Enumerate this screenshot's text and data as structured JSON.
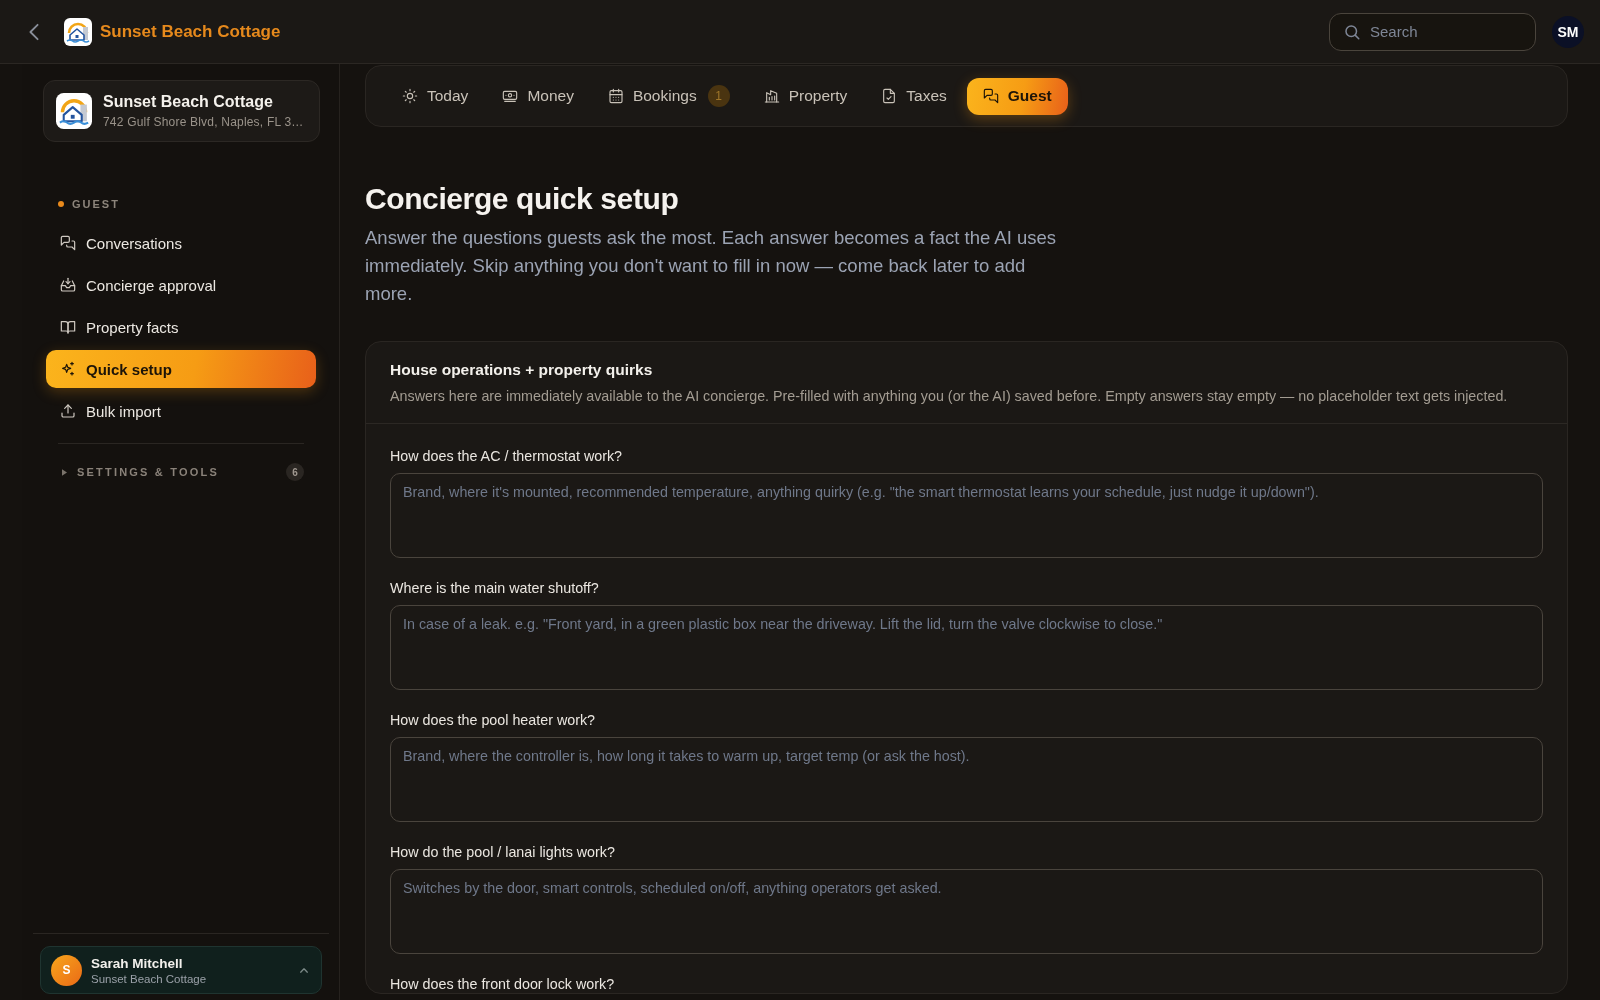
{
  "top_bar": {
    "title": "Sunset Beach Cottage",
    "search": {
      "placeholder": "Search"
    },
    "avatar": "SM"
  },
  "sidebar": {
    "property": {
      "name": "Sunset Beach Cottage",
      "address": "742 Gulf Shore Blvd, Naples, FL 3…"
    },
    "section": "GUEST",
    "items": [
      {
        "label": "Conversations",
        "selected": false
      },
      {
        "label": "Concierge approval",
        "selected": false
      },
      {
        "label": "Property facts",
        "selected": false
      },
      {
        "label": "Quick setup",
        "selected": true
      },
      {
        "label": "Bulk import",
        "selected": false
      }
    ],
    "settings": {
      "label": "SETTINGS & TOOLS",
      "expanded": false,
      "count": "6"
    },
    "user": {
      "initial": "S",
      "name": "Sarah Mitchell",
      "subtitle": "Sunset Beach Cottage"
    }
  },
  "tabs": [
    {
      "label": "Today",
      "selected": false
    },
    {
      "label": "Money",
      "selected": false
    },
    {
      "label": "Bookings",
      "badge": "1",
      "selected": false
    },
    {
      "label": "Property",
      "selected": false
    },
    {
      "label": "Taxes",
      "selected": false
    },
    {
      "label": "Guest",
      "selected": true
    }
  ],
  "page": {
    "title": "Concierge quick setup",
    "intro": "Answer the questions guests ask the most. Each answer becomes a fact the AI uses immediately. Skip anything you don't want to fill in now — come back later to add more."
  },
  "card": {
    "title": "House operations + property quirks",
    "description": "Answers here are immediately available to the AI concierge. Pre-filled with anything you (or the AI) saved before. Empty answers stay empty — no placeholder text gets injected.",
    "questions": [
      {
        "label": "How does the AC / thermostat work?",
        "placeholder": "Brand, where it's mounted, recommended temperature, anything quirky (e.g. \"the smart thermostat learns your schedule, just nudge it up/down\")."
      },
      {
        "label": "Where is the main water shutoff?",
        "placeholder": "In case of a leak. e.g. \"Front yard, in a green plastic box near the driveway. Lift the lid, turn the valve clockwise to close.\""
      },
      {
        "label": "How does the pool heater work?",
        "placeholder": "Brand, where the controller is, how long it takes to warm up, target temp (or ask the host)."
      },
      {
        "label": "How do the pool / lanai lights work?",
        "placeholder": "Switches by the door, smart controls, scheduled on/off, anything operators get asked."
      },
      {
        "label": "How does the front door lock work?"
      }
    ]
  }
}
